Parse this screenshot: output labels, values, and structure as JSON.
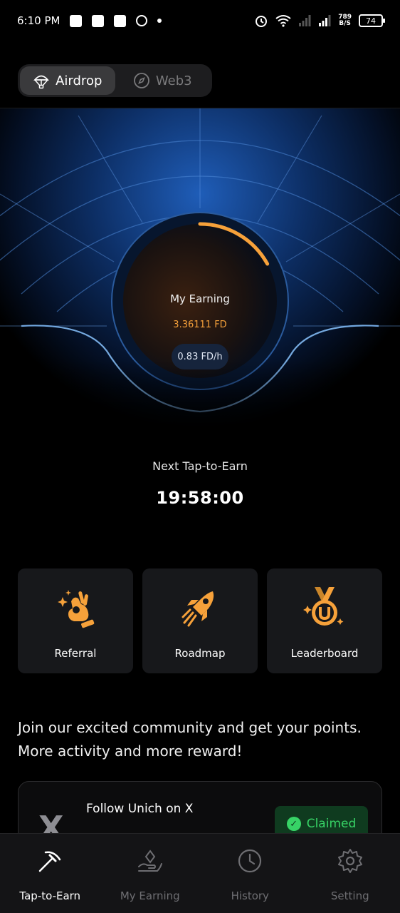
{
  "status_bar": {
    "time": "6:10 PM",
    "speed_value": "789",
    "speed_unit": "B/S",
    "battery": "74"
  },
  "toggle": {
    "tabs": [
      {
        "label": "Airdrop",
        "icon": "parachute-icon",
        "active": true
      },
      {
        "label": "Web3",
        "icon": "compass-icon",
        "active": false
      }
    ]
  },
  "earning": {
    "label": "My Earning",
    "value": "3.36111 FD",
    "rate": "0.83 FD/h",
    "progress": 0.17,
    "accent_color": "#f6a13a"
  },
  "next_tap": {
    "label": "Next Tap-to-Earn",
    "countdown": "19:58:00"
  },
  "cards": [
    {
      "label": "Referral",
      "icon": "ok-hand-icon"
    },
    {
      "label": "Roadmap",
      "icon": "rocket-icon"
    },
    {
      "label": "Leaderboard",
      "icon": "medal-icon"
    }
  ],
  "community_text": "Join our excited community and get your points. More activity and more reward!",
  "task": {
    "title": "Follow Unich on X",
    "status": "Claimed"
  },
  "bottom_nav": [
    {
      "label": "Tap-to-Earn",
      "icon": "pickaxe-icon",
      "active": true
    },
    {
      "label": "My Earning",
      "icon": "hand-diamond-icon",
      "active": false
    },
    {
      "label": "History",
      "icon": "clock-icon",
      "active": false
    },
    {
      "label": "Setting",
      "icon": "gear-icon",
      "active": false
    }
  ]
}
